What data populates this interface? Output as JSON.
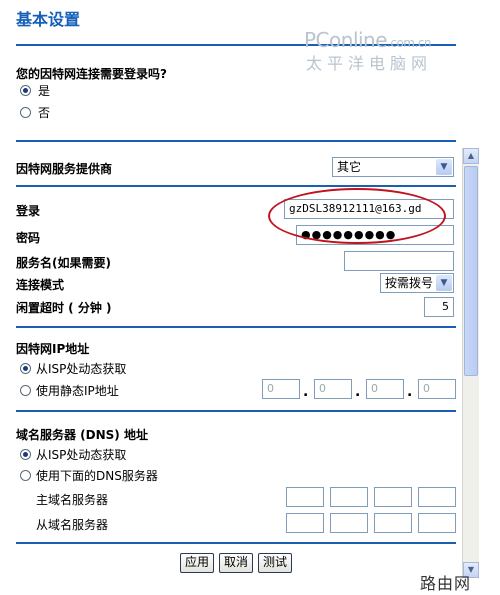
{
  "page": {
    "title": "基本设置"
  },
  "watermark": {
    "line1": "PConline",
    "line1_suffix": ".com.cn",
    "line2": "太平洋电脑网",
    "corner": "路由网"
  },
  "login_required": {
    "question": "您的因特网连接需要登录吗?",
    "options": [
      {
        "label": "是",
        "checked": true
      },
      {
        "label": "否",
        "checked": false
      }
    ]
  },
  "isp": {
    "label": "因特网服务提供商",
    "selected": "其它",
    "dropdown_icon": "chevron-down-icon"
  },
  "account": {
    "login_label": "登录",
    "login_value": "gzDSL38912111@163.gd",
    "password_label": "密码",
    "password_value": "●●●●●●●●●",
    "service_label": "服务名(如果需要)",
    "service_value": "",
    "mode_label": "连接模式",
    "mode_value": "按需拨号",
    "idle_label": "闲置超时 ( 分钟 )",
    "idle_value": "5"
  },
  "ip_address": {
    "heading": "因特网IP地址",
    "options": [
      {
        "label": "从ISP处动态获取",
        "checked": true
      },
      {
        "label": "使用静态IP地址",
        "checked": false
      }
    ],
    "octets": [
      "0",
      "0",
      "0",
      "0"
    ]
  },
  "dns": {
    "heading": "域名服务器 (DNS) 地址",
    "options": [
      {
        "label": "从ISP处动态获取",
        "checked": true
      },
      {
        "label": "使用下面的DNS服务器",
        "checked": false
      }
    ],
    "primary_label": "主域名服务器",
    "secondary_label": "从域名服务器"
  },
  "buttons": {
    "apply": "应用",
    "cancel": "取消",
    "test": "测试"
  },
  "colors": {
    "title": "#1560b8",
    "rule": "#1a5fb0",
    "highlight_oval": "#c1121f"
  }
}
